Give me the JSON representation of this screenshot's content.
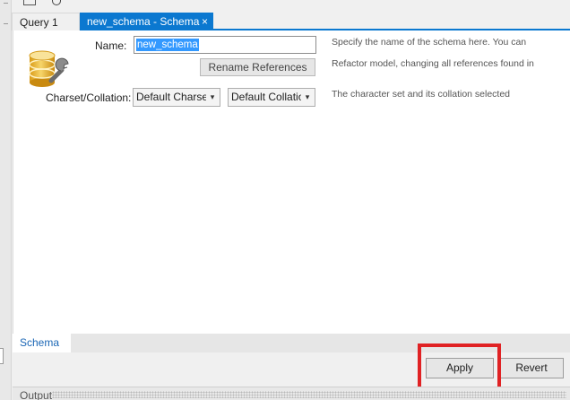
{
  "document_tabs": {
    "query_tab": "Query 1",
    "schema_tab": "new_schema - Schema",
    "close_glyph": "×"
  },
  "form": {
    "name_label": "Name:",
    "name_value": "new_schema",
    "rename_button": "Rename References",
    "charset_label": "Charset/Collation:",
    "charset_selected": "Default Charset",
    "collation_selected": "Default Collation",
    "icon": "database-wrench-icon"
  },
  "help": {
    "line1": "Specify the name of the schema here. You can",
    "line2": "Refactor model, changing all references found in",
    "line3": "The character set and its collation selected"
  },
  "bottom_tabs": {
    "schema": "Schema"
  },
  "actions": {
    "apply": "Apply",
    "revert": "Revert"
  },
  "output": {
    "label": "Output"
  },
  "colors": {
    "accent": "#0b78d0",
    "highlight_box": "#e02224"
  }
}
